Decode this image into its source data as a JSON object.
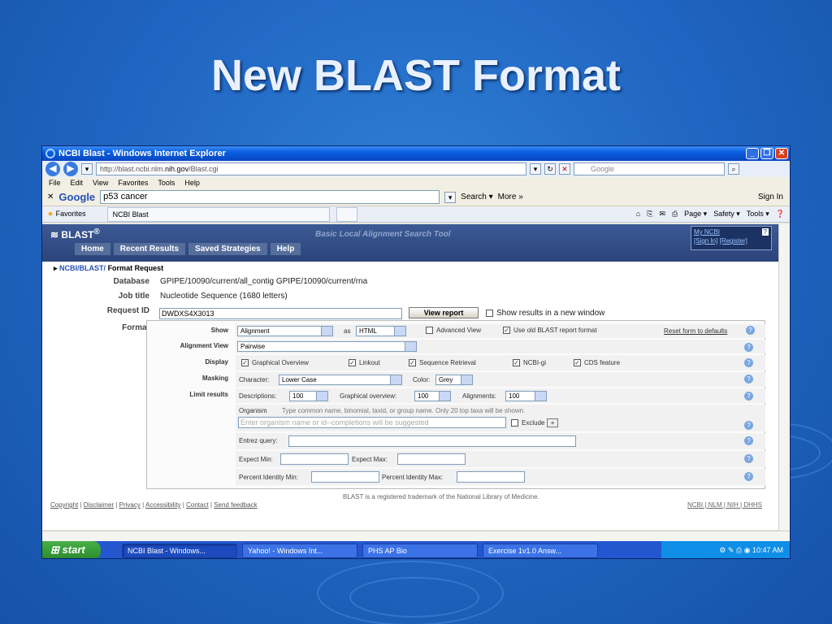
{
  "slide": {
    "title": "New BLAST Format"
  },
  "window": {
    "title": "NCBI Blast - Windows Internet Explorer"
  },
  "addressbar": {
    "url_prefix": "http://blast.ncbi.nlm.",
    "url_domain": "nih.gov",
    "url_suffix": "/Blast.cgi",
    "search_placeholder": "Google"
  },
  "menubar": {
    "items": [
      "File",
      "Edit",
      "View",
      "Favorites",
      "Tools",
      "Help"
    ]
  },
  "google_toolbar": {
    "logo": "Google",
    "query": "p53 cancer",
    "search_label": "Search ▾",
    "more_label": "More »",
    "signin_label": "Sign In"
  },
  "favorites_bar": {
    "favorites_label": "Favorites",
    "tab_title": "NCBI Blast",
    "commands": [
      "Page ▾",
      "Safety ▾",
      "Tools ▾"
    ]
  },
  "ncbi": {
    "logo": "BLAST",
    "logo_sup": "®",
    "tagline": "Basic Local Alignment Search Tool",
    "nav": [
      "Home",
      "Recent Results",
      "Saved Strategies",
      "Help"
    ],
    "my_ncbi": "My NCBI",
    "sign_in": "[Sign In]",
    "register": "[Register]",
    "breadcrumb": {
      "ncbi": "NCBI/",
      "blast": "BLAST/",
      "current": "Format Request"
    }
  },
  "request": {
    "database_label": "Database",
    "database_value": "GPIPE/10090/current/all_contig GPIPE/10090/current/rna",
    "jobtitle_label": "Job title",
    "jobtitle_value": "Nucleotide Sequence (1680 letters)",
    "requestid_label": "Request ID",
    "requestid_value": "DWDXS4X3013",
    "view_report_button": "View report",
    "new_window_label": "Show results in a new window",
    "format_label": "Format"
  },
  "format": {
    "show_label": "Show",
    "show_value": "Alignment",
    "as_label": "as",
    "as_value": "HTML",
    "advanced_view_label": "Advanced View",
    "use_old_label": "Use old BLAST report format",
    "reset_label": "Reset form to defaults",
    "alignment_view_label": "Alignment View",
    "alignment_view_value": "Pairwise",
    "display_label": "Display",
    "display_options": [
      "Graphical Overview",
      "Linkout",
      "Sequence Retrieval",
      "NCBI-gi",
      "CDS feature"
    ],
    "masking_label": "Masking",
    "character_label": "Character:",
    "character_value": "Lower Case",
    "color_label": "Color:",
    "color_value": "Grey",
    "limit_label": "Limit results",
    "descriptions_label": "Descriptions:",
    "descriptions_value": "100",
    "graphical_label": "Graphical overview:",
    "graphical_value": "100",
    "alignments_label": "Alignments:",
    "alignments_value": "100",
    "organism_label": "Organism",
    "organism_hint": "Type common name, binomial, taxid, or group name. Only 20 top taxa will be shown.",
    "organism_placeholder": "Enter organism name or id--completions will be suggested",
    "exclude_label": "Exclude",
    "entrez_label": "Entrez query:",
    "expect_min_label": "Expect Min:",
    "expect_max_label": "Expect Max:",
    "pct_min_label": "Percent Identity Min:",
    "pct_max_label": "Percent Identity Max:"
  },
  "footer": {
    "links": [
      "Copyright",
      "Disclaimer",
      "Privacy",
      "Accessibility",
      "Contact",
      "Send feedback"
    ],
    "trademark": "BLAST is a registered trademark of the National Library of Medicine.",
    "right_links": "NCBI | NLM | NIH | DHHS"
  },
  "taskbar": {
    "start": "start",
    "tasks": [
      "NCBI Blast - Windows...",
      "Yahoo! - Windows Int...",
      "PHS AP Bio",
      "Exercise 1v1.0 Answ..."
    ],
    "clock": "10:47 AM"
  }
}
